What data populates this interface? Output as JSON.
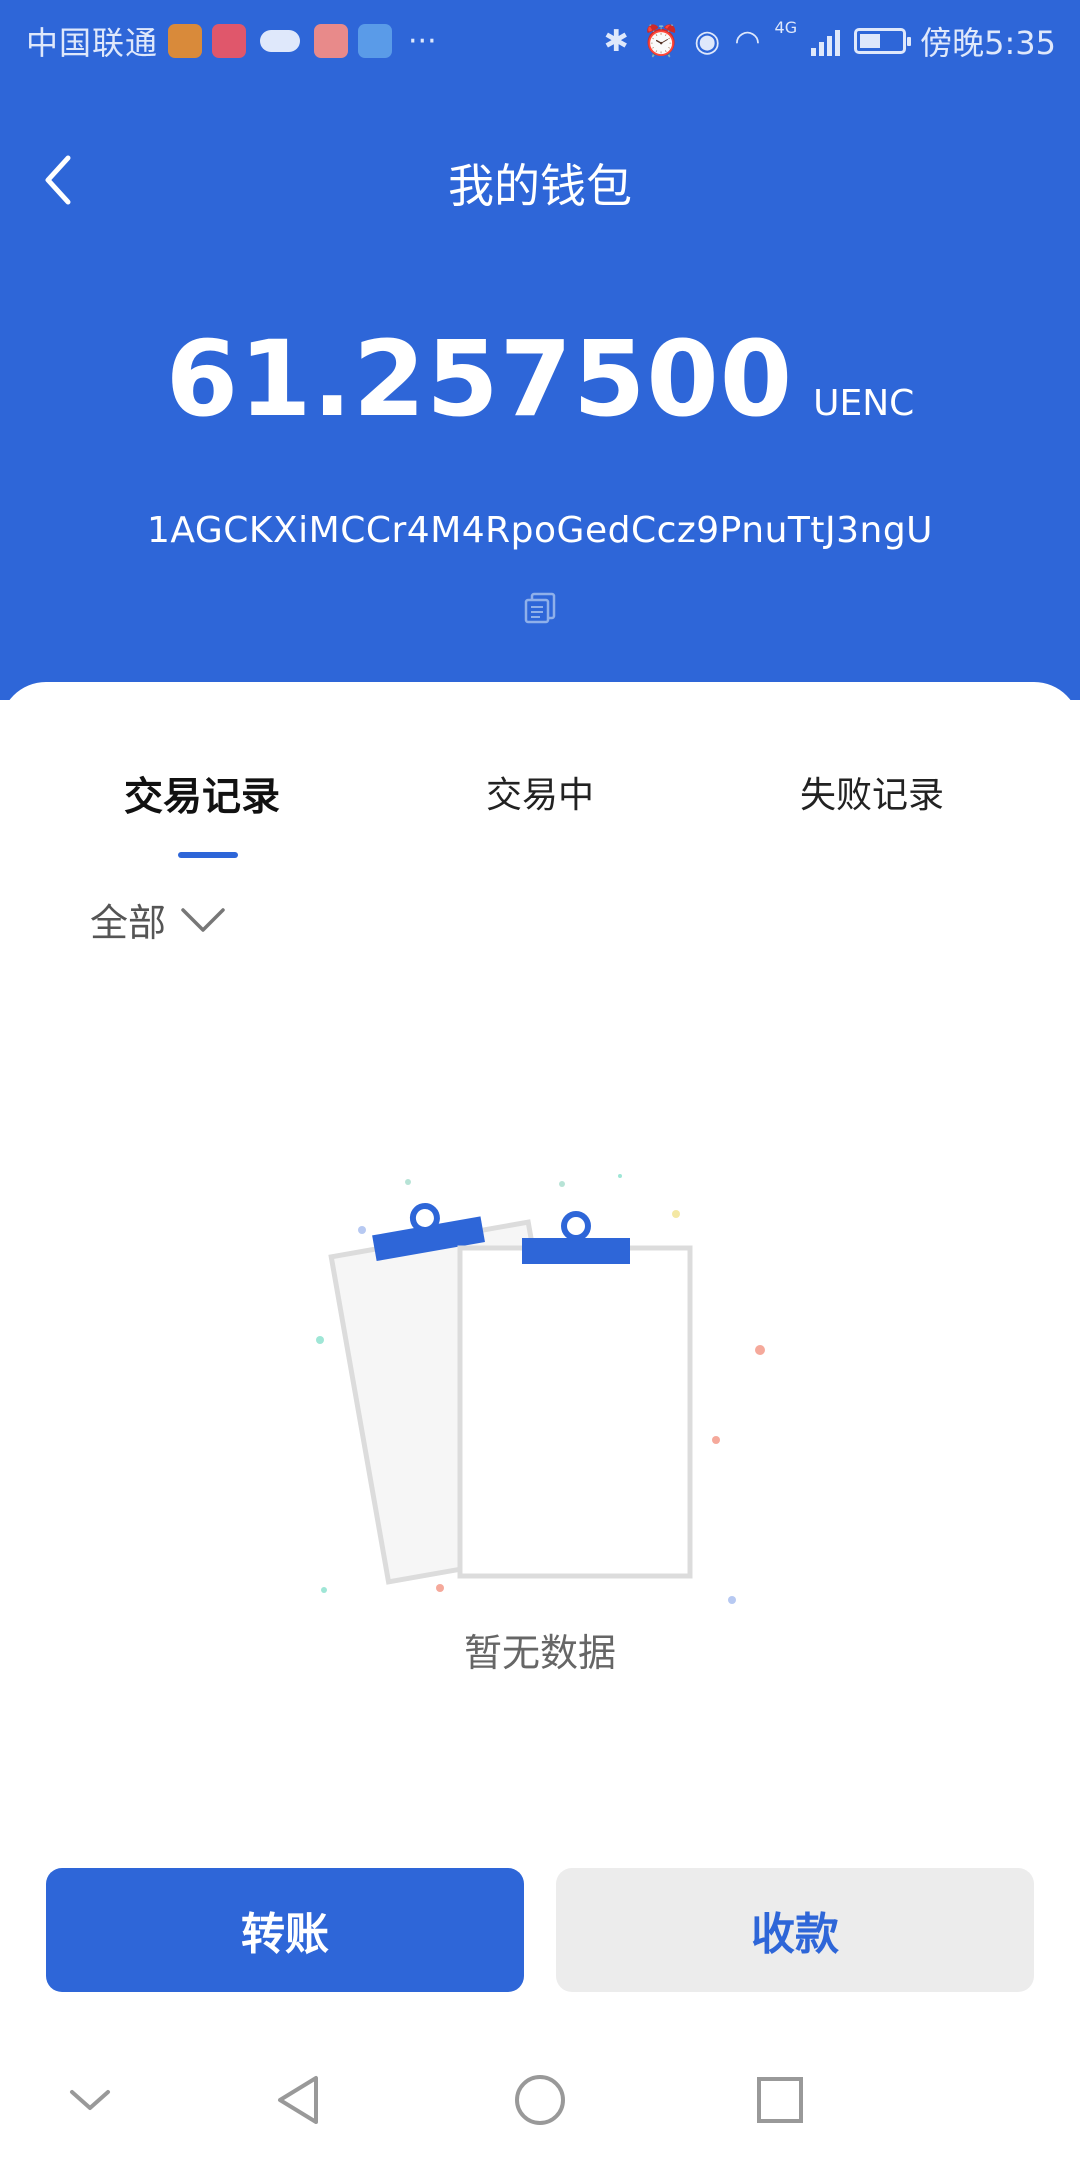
{
  "status_bar": {
    "carrier": "中国联通",
    "more": "···",
    "network": "4G",
    "time": "傍晚5:35",
    "battery_level": 0.5
  },
  "header": {
    "title": "我的钱包"
  },
  "wallet": {
    "balance": "61.257500",
    "unit": "UENC",
    "address": "1AGCKXiMCCr4M4RpoGedCcz9PnuTtJ3ngU"
  },
  "tabs": [
    {
      "label": "交易记录",
      "active": true
    },
    {
      "label": "交易中",
      "active": false
    },
    {
      "label": "失败记录",
      "active": false
    }
  ],
  "filter": {
    "label": "全部"
  },
  "empty_state": {
    "text": "暂无数据"
  },
  "actions": {
    "transfer": "转账",
    "receive": "收款"
  },
  "colors": {
    "primary": "#2e66d8",
    "secondary_button": "#ececec"
  },
  "icons": {
    "back": "back-arrow-icon",
    "copy": "copy-icon",
    "filter": "chevron-down-icon",
    "empty": "clipboard-illustration"
  }
}
